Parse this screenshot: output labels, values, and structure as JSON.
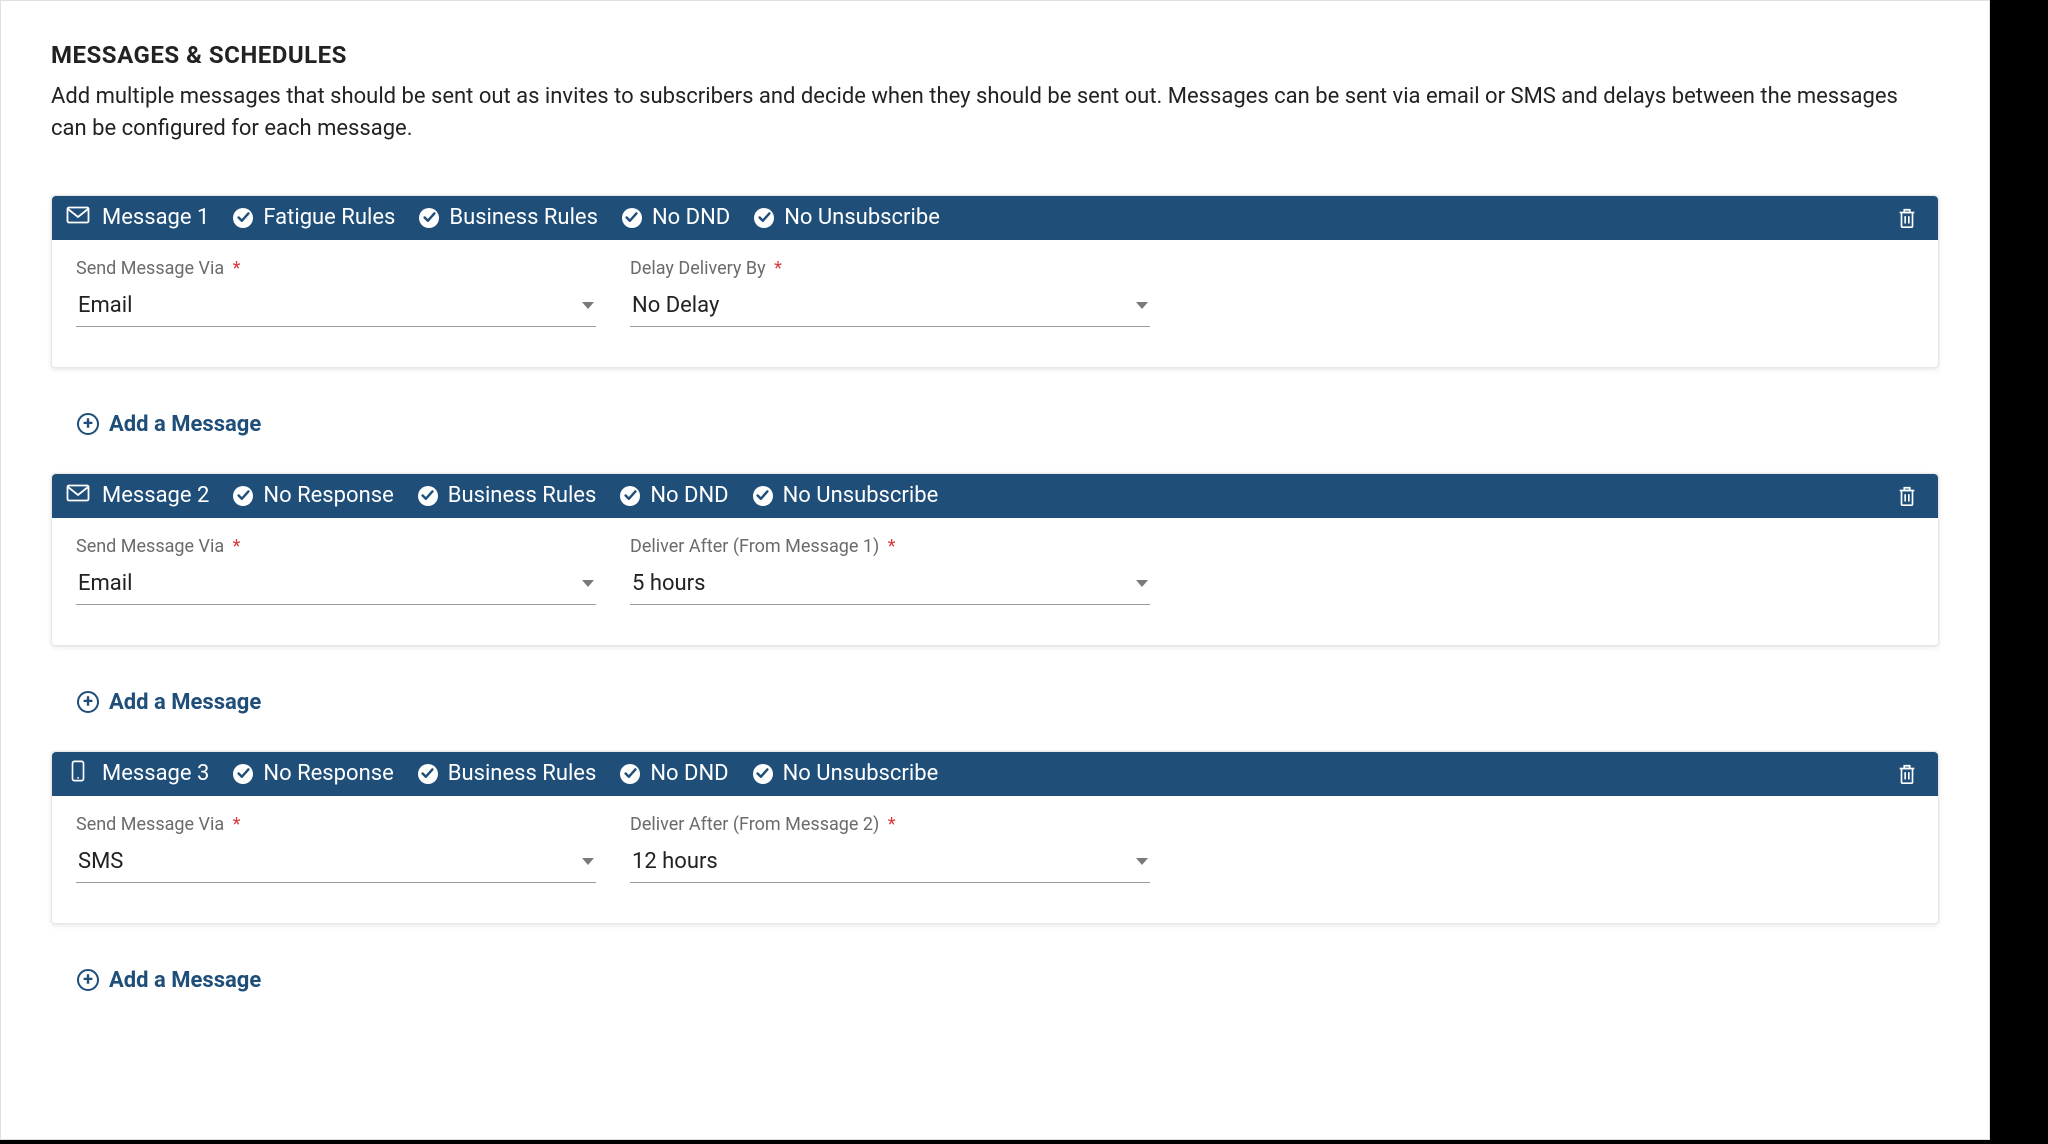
{
  "section": {
    "title": "MESSAGES & SCHEDULES",
    "description": "Add multiple messages that should be sent out as invites to subscribers and decide when they should be sent out. Messages can be sent via email or SMS and delays between the messages can be configured for each message."
  },
  "add_button_label": "Add a Message",
  "messages": [
    {
      "title": "Message 1",
      "channel_icon": "email",
      "tags": [
        "Fatigue Rules",
        "Business Rules",
        "No DND",
        "No Unsubscribe"
      ],
      "fields": {
        "send_via_label": "Send Message Via",
        "send_via_value": "Email",
        "delay_label": "Delay Delivery By",
        "delay_value": "No Delay"
      }
    },
    {
      "title": "Message 2",
      "channel_icon": "email",
      "tags": [
        "No Response",
        "Business Rules",
        "No DND",
        "No Unsubscribe"
      ],
      "fields": {
        "send_via_label": "Send Message Via",
        "send_via_value": "Email",
        "delay_label": "Deliver After (From Message 1)",
        "delay_value": "5 hours"
      }
    },
    {
      "title": "Message 3",
      "channel_icon": "sms",
      "tags": [
        "No Response",
        "Business Rules",
        "No DND",
        "No Unsubscribe"
      ],
      "fields": {
        "send_via_label": "Send Message Via",
        "send_via_value": "SMS",
        "delay_label": "Deliver After (From Message 2)",
        "delay_value": "12 hours"
      }
    }
  ]
}
